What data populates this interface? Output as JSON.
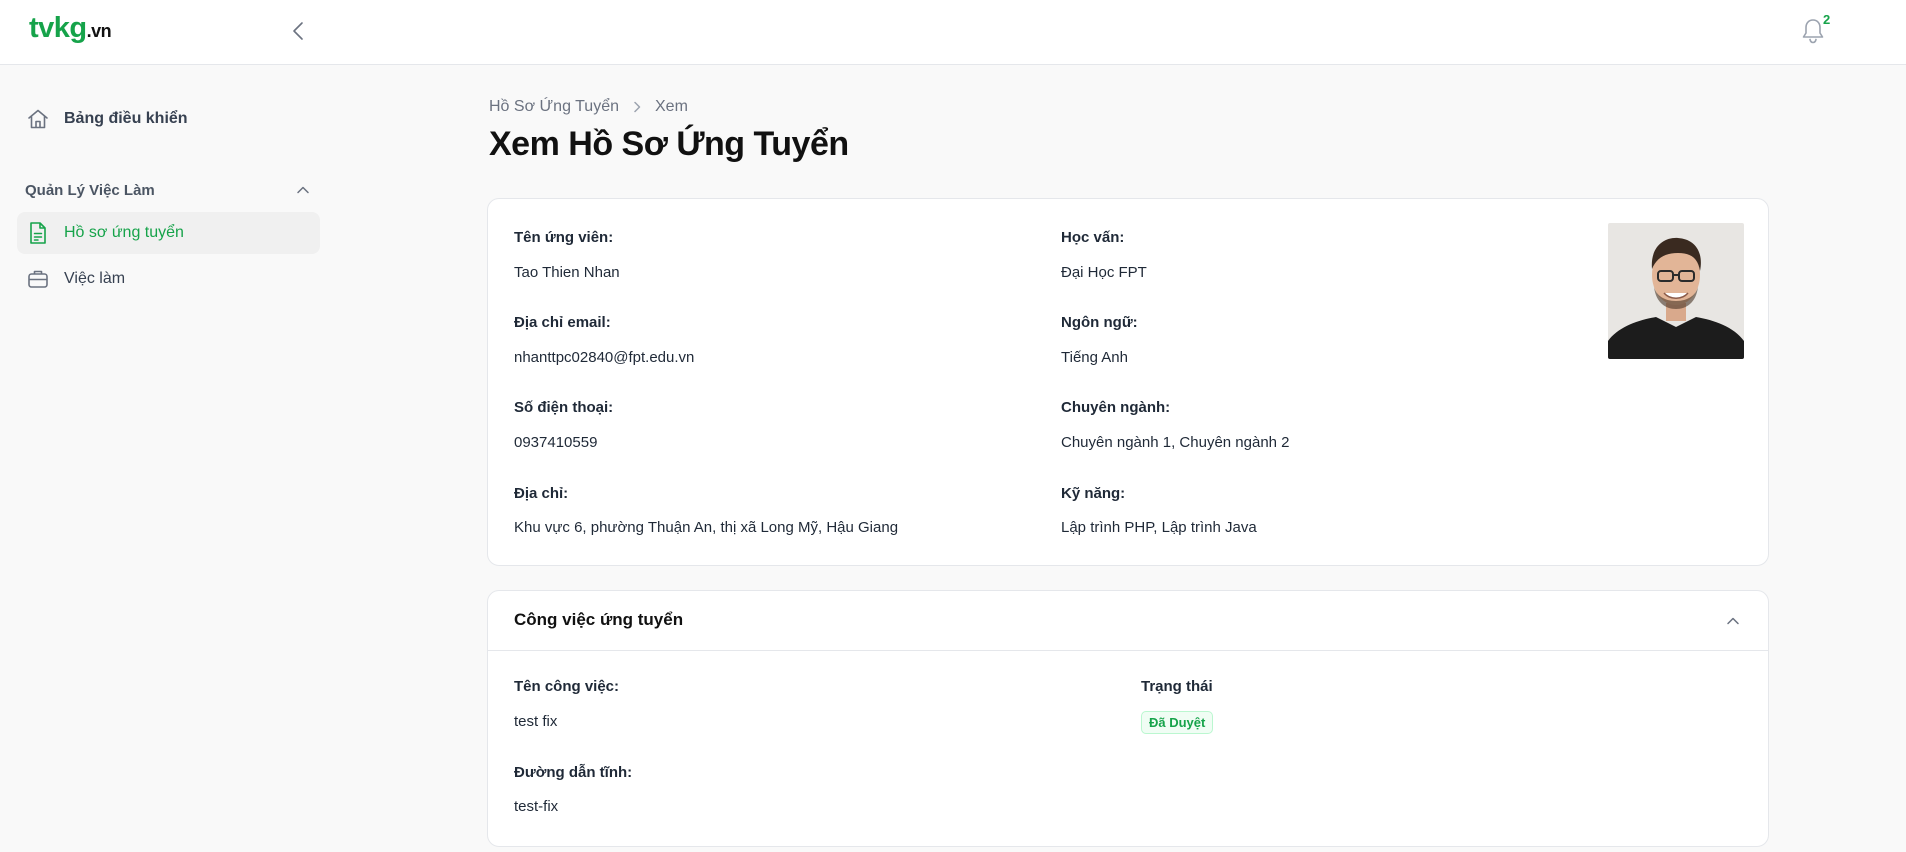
{
  "header": {
    "logo_brand": "tvkg",
    "logo_tld": ".vn",
    "notification_count": "2"
  },
  "sidebar": {
    "dashboard_label": "Bảng điều khiển",
    "group_label": "Quản Lý Việc Làm",
    "items": [
      {
        "label": "Hồ sơ ứng tuyển",
        "icon": "document-icon",
        "active": true
      },
      {
        "label": "Việc làm",
        "icon": "briefcase-icon",
        "active": false
      }
    ]
  },
  "breadcrumb": {
    "parent": "Hồ Sơ Ứng Tuyển",
    "current": "Xem"
  },
  "page_title": "Xem Hồ Sơ Ứng Tuyển",
  "candidate": {
    "name_label": "Tên ứng viên:",
    "name": "Tao Thien Nhan",
    "email_label": "Địa chỉ email:",
    "email": "nhanttpc02840@fpt.edu.vn",
    "phone_label": "Số điện thoại:",
    "phone": "0937410559",
    "address_label": "Địa chỉ:",
    "address": "Khu vực 6, phường Thuận An, thị xã Long Mỹ, Hậu Giang",
    "education_label": "Học vấn:",
    "education": "Đại Học FPT",
    "language_label": "Ngôn ngữ:",
    "language": "Tiếng Anh",
    "major_label": "Chuyên ngành:",
    "major": "Chuyên ngành 1, Chuyên ngành 2",
    "skills_label": "Kỹ năng:",
    "skills": "Lập trình PHP, Lập trình Java"
  },
  "job": {
    "section_title": "Công việc ứng tuyển",
    "title_label": "Tên công việc:",
    "title": "test fix",
    "slug_label": "Đường dẫn tĩnh:",
    "slug": "test-fix",
    "status_label": "Trạng thái",
    "status": "Đã Duyệt"
  },
  "colors": {
    "accent": "#16a34a",
    "background": "#f9f9f9",
    "card": "#ffffff"
  }
}
